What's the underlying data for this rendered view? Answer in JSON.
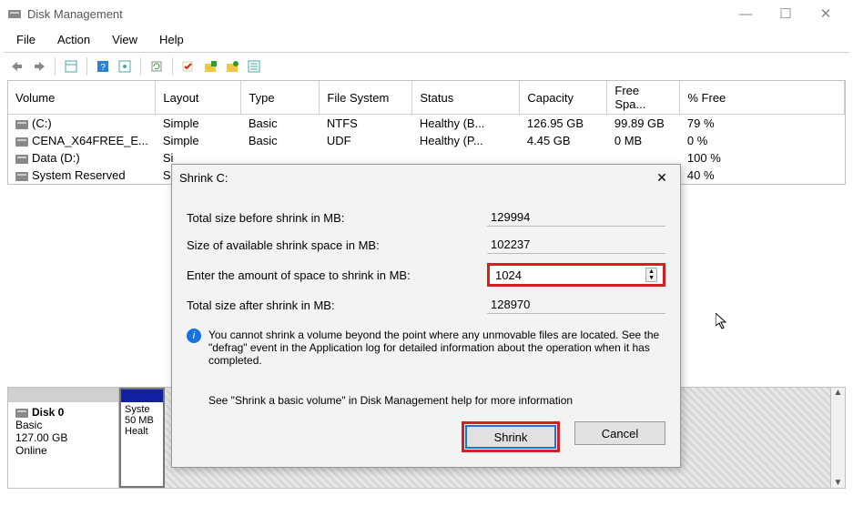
{
  "window": {
    "title": "Disk Management",
    "menu": {
      "file": "File",
      "action": "Action",
      "view": "View",
      "help": "Help"
    }
  },
  "columns": {
    "volume": "Volume",
    "layout": "Layout",
    "type": "Type",
    "filesystem": "File System",
    "status": "Status",
    "capacity": "Capacity",
    "freespace": "Free Spa...",
    "pctfree": "% Free"
  },
  "rows": [
    {
      "vol": "(C:)",
      "layout": "Simple",
      "type": "Basic",
      "fs": "NTFS",
      "status": "Healthy (B...",
      "cap": "126.95 GB",
      "free": "99.89 GB",
      "pct": "79 %"
    },
    {
      "vol": "CENA_X64FREE_E...",
      "layout": "Simple",
      "type": "Basic",
      "fs": "UDF",
      "status": "Healthy (P...",
      "cap": "4.45 GB",
      "free": "0 MB",
      "pct": "0 %"
    },
    {
      "vol": "Data (D:)",
      "layout": "Si",
      "type": "",
      "fs": "",
      "status": "",
      "cap": "",
      "free": "",
      "pct": "100 %"
    },
    {
      "vol": "System Reserved",
      "layout": "Si",
      "type": "",
      "fs": "",
      "status": "",
      "cap": "",
      "free": "",
      "pct": "40 %"
    }
  ],
  "disk": {
    "label": "Disk 0",
    "type": "Basic",
    "capacity": "127.00 GB",
    "status": "Online",
    "part1": {
      "name": "Syste",
      "size": "50 MB",
      "status": "Healt"
    }
  },
  "dialog": {
    "title": "Shrink C:",
    "labels": {
      "total_before": "Total size before shrink in MB:",
      "available": "Size of available shrink space in MB:",
      "enter": "Enter the amount of space to shrink in MB:",
      "total_after": "Total size after shrink in MB:"
    },
    "values": {
      "total_before": "129994",
      "available": "102237",
      "enter": "1024",
      "total_after": "128970"
    },
    "info1": "You cannot shrink a volume beyond the point where any unmovable files are located. See the \"defrag\" event in the Application log for detailed information about the operation when it has completed.",
    "info2": "See \"Shrink a basic volume\" in Disk Management help for more information",
    "buttons": {
      "shrink": "Shrink",
      "cancel": "Cancel"
    }
  }
}
